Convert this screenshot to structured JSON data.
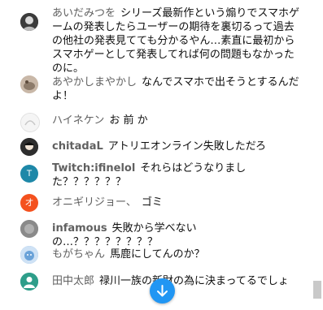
{
  "messages": [
    {
      "author": "あいだみつを",
      "bold": false,
      "text": "シリーズ最新作という煽りでスマホゲームの発表したらユーザーの期待を裏切るって過去の他社の発表見てても分かるやん…素直に最初からスマホゲーとして発表してれば何の問題もなかったのに。",
      "avatar_letter": "",
      "avatar_color": "#3b3b3b"
    },
    {
      "author": "あやかしまやかし",
      "bold": false,
      "text": "なんでスマホで出そうとするんだよ！",
      "avatar_letter": "",
      "avatar_color": "#c9b8a8"
    },
    {
      "author": "ハイネケン",
      "bold": false,
      "text": "お 前 か",
      "avatar_letter": "",
      "avatar_color": "#e8e8e8"
    },
    {
      "author": "chitadaL",
      "bold": true,
      "text": "アトリエオンライン失敗しただろ",
      "avatar_letter": "",
      "avatar_color": "#2e2e2e"
    },
    {
      "author": "Twitch:ifinelol",
      "bold": true,
      "text": "それらはどうなりました？？？？？？",
      "avatar_letter": "T",
      "avatar_color": "#1e88a8"
    },
    {
      "author": "オニギリジョー、",
      "bold": false,
      "text": "ゴミ",
      "avatar_letter": "オ",
      "avatar_color": "#f4511e"
    },
    {
      "author": "infamous",
      "bold": true,
      "text": "失敗から学べないの…？？？？？？？？",
      "avatar_letter": "",
      "avatar_color": "#8a8a8a"
    },
    {
      "author": "もがちゃん",
      "bold": false,
      "text": "馬鹿にしてんのか？",
      "avatar_letter": "",
      "avatar_color": "#6aa2d8"
    },
    {
      "author": "田中太郎",
      "bold": false,
      "text": "禄川一族の新財の為に決まってるでしょ",
      "avatar_letter": "",
      "avatar_color": "#2e9e8a"
    }
  ],
  "colors": {
    "accent": "#2196f3",
    "author_text": "#606060",
    "message_text": "#0f0f0f"
  },
  "controls": {
    "jump_icon": "arrow-down-icon",
    "scrollbar": "vertical"
  }
}
